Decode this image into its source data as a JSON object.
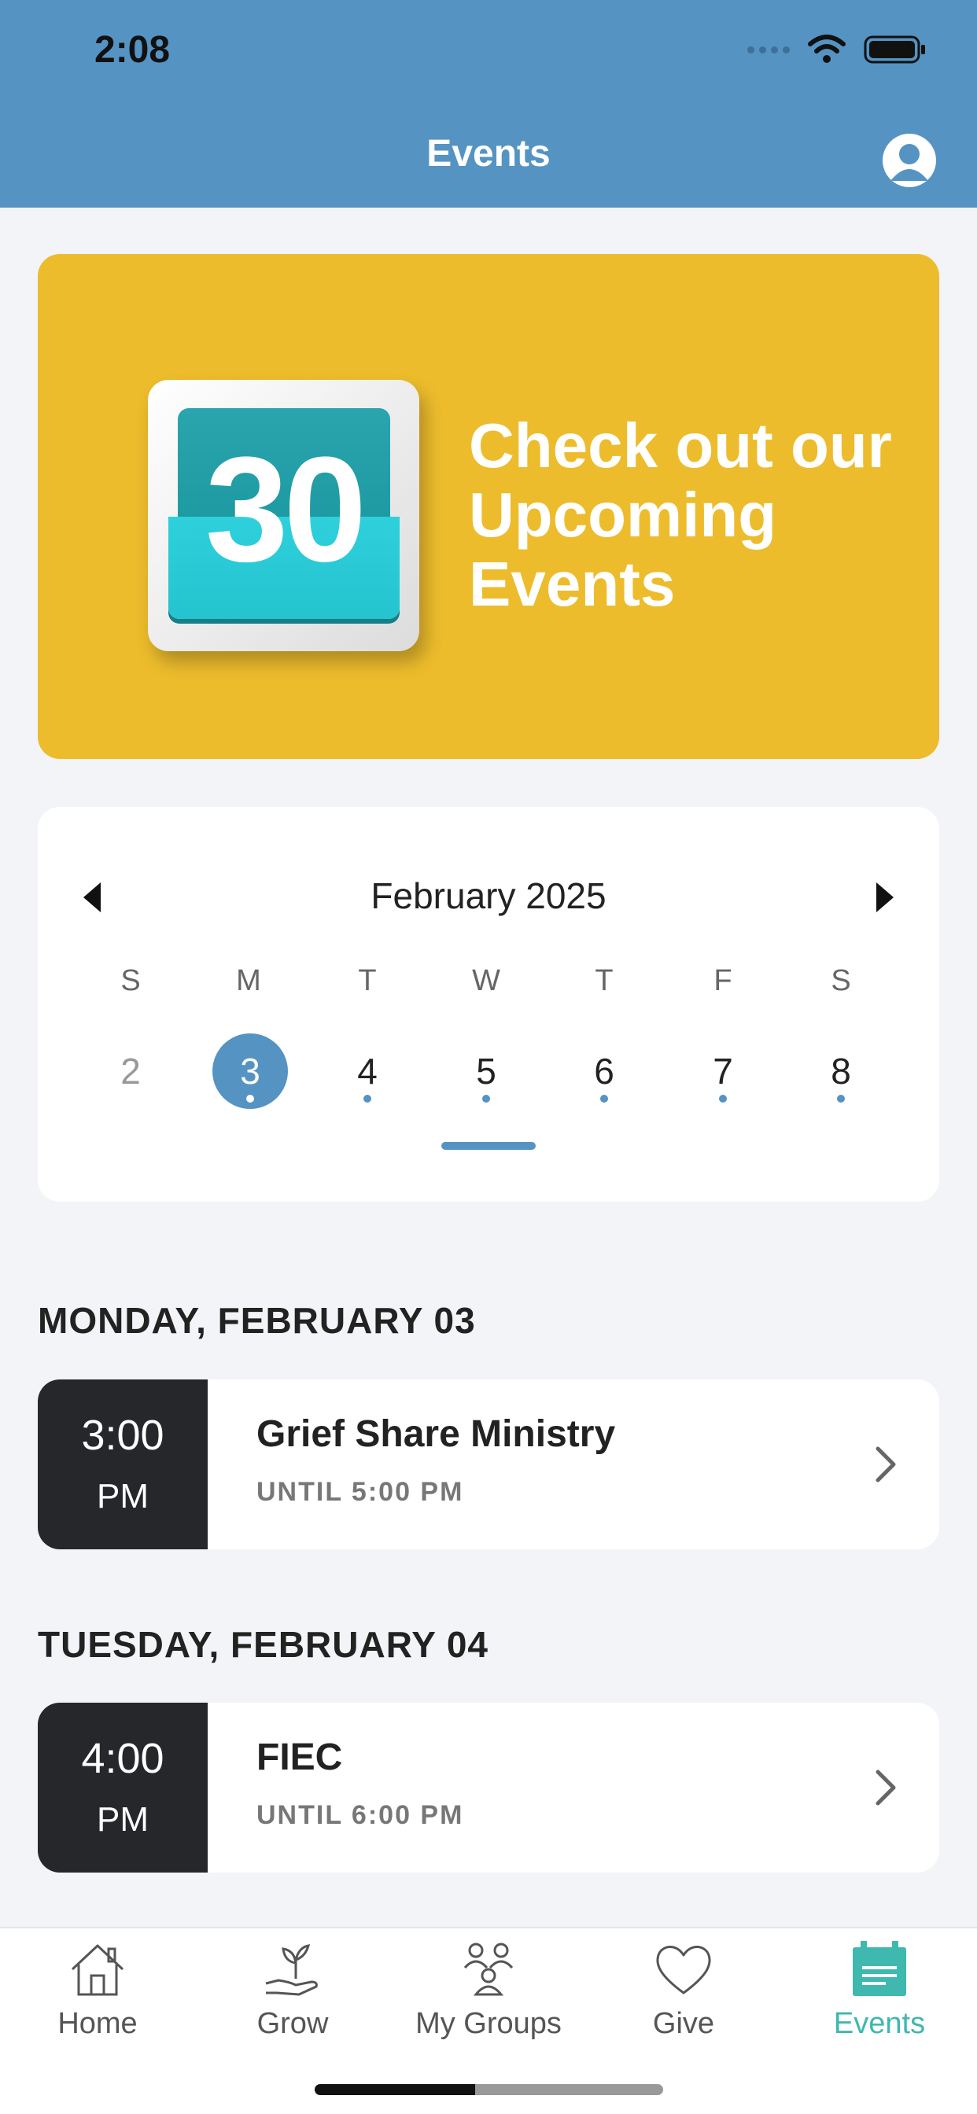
{
  "status": {
    "time": "2:08"
  },
  "header": {
    "title": "Events"
  },
  "banner": {
    "calendar_number": "30",
    "line1": "Check out our",
    "line2": "Upcoming",
    "line3": "Events"
  },
  "calendar": {
    "month": "February 2025",
    "weekdays": [
      "S",
      "M",
      "T",
      "W",
      "T",
      "F",
      "S"
    ],
    "days": [
      "2",
      "3",
      "4",
      "5",
      "6",
      "7",
      "8"
    ],
    "selected_day": "3"
  },
  "sections": [
    {
      "title": "MONDAY, FEBRUARY 03",
      "event": {
        "time": "3:00",
        "ampm": "PM",
        "name": "Grief Share Ministry",
        "until": "UNTIL 5:00 PM"
      }
    },
    {
      "title": "TUESDAY, FEBRUARY 04",
      "event": {
        "time": "4:00",
        "ampm": "PM",
        "name": "FIEC",
        "until": "UNTIL 6:00 PM"
      }
    }
  ],
  "tabs": [
    {
      "label": "Home",
      "icon": "home-icon"
    },
    {
      "label": "Grow",
      "icon": "plant-icon"
    },
    {
      "label": "My Groups",
      "icon": "groups-icon"
    },
    {
      "label": "Give",
      "icon": "heart-icon"
    },
    {
      "label": "Events",
      "icon": "calendar-icon",
      "active": true
    }
  ],
  "colors": {
    "header": "#5593c3",
    "banner": "#ecbc2c",
    "active_tab": "#3fb8b0",
    "time_block": "#26272b"
  }
}
